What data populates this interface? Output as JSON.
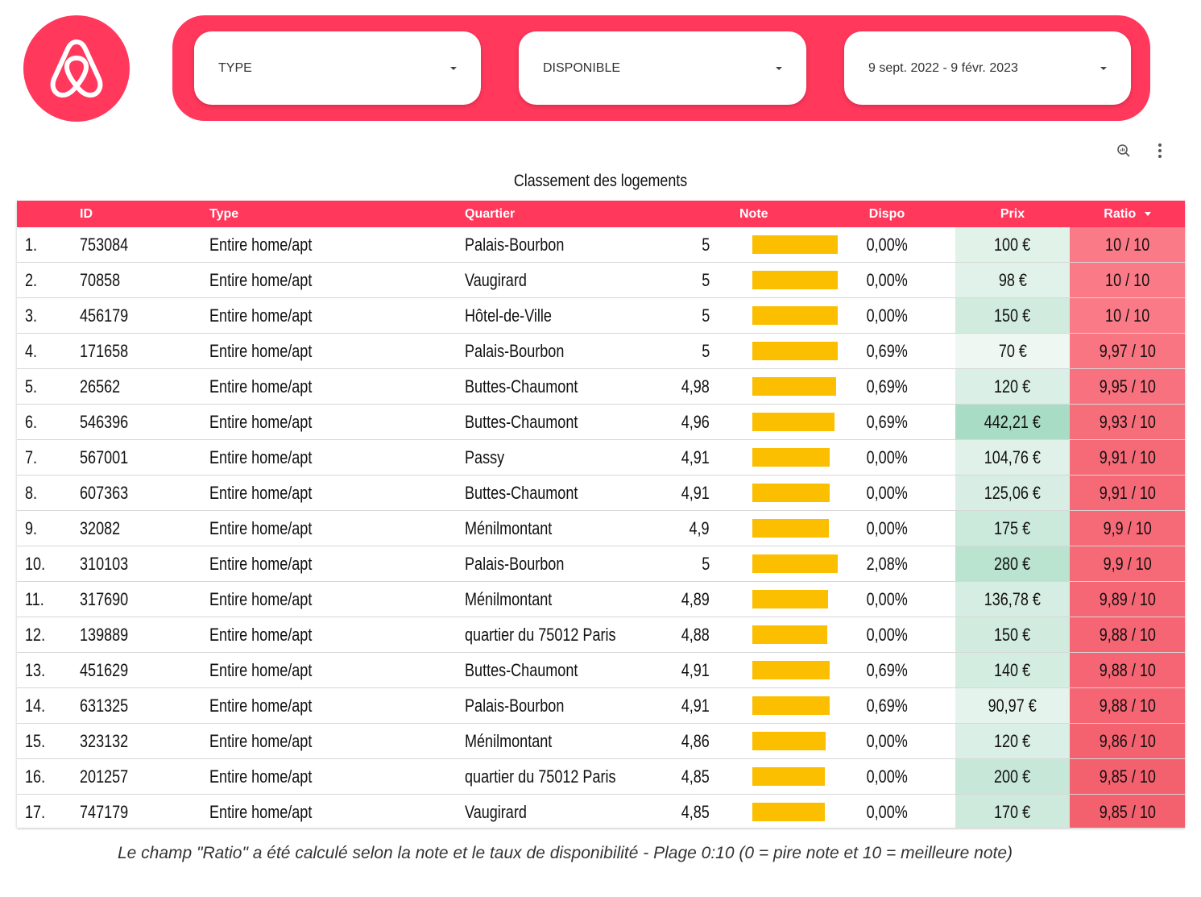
{
  "filters": {
    "type_label": "TYPE",
    "dispo_label": "DISPONIBLE",
    "date_label": "9 sept. 2022 - 9 févr. 2023"
  },
  "colors": {
    "brand": "#ff385c",
    "note_bar": "#fbbf00"
  },
  "table": {
    "title": "Classement des logements",
    "headers": {
      "id": "ID",
      "type": "Type",
      "quartier": "Quartier",
      "note": "Note",
      "dispo": "Dispo",
      "prix": "Prix",
      "ratio": "Ratio"
    },
    "sort_icon": "arrow-down-icon",
    "rows": [
      {
        "rank": "1.",
        "id": "753084",
        "type": "Entire home/apt",
        "quartier": "Palais-Bourbon",
        "note": "5",
        "note_value": 5,
        "dispo": "0,00%",
        "prix": "100 €",
        "price_value": 100,
        "ratio": "10 / 10",
        "ratio_value": 10
      },
      {
        "rank": "2.",
        "id": "70858",
        "type": "Entire home/apt",
        "quartier": "Vaugirard",
        "note": "5",
        "note_value": 5,
        "dispo": "0,00%",
        "prix": "98 €",
        "price_value": 98,
        "ratio": "10 / 10",
        "ratio_value": 10
      },
      {
        "rank": "3.",
        "id": "456179",
        "type": "Entire home/apt",
        "quartier": "Hôtel-de-Ville",
        "note": "5",
        "note_value": 5,
        "dispo": "0,00%",
        "prix": "150 €",
        "price_value": 150,
        "ratio": "10 / 10",
        "ratio_value": 10
      },
      {
        "rank": "4.",
        "id": "171658",
        "type": "Entire home/apt",
        "quartier": "Palais-Bourbon",
        "note": "5",
        "note_value": 5,
        "dispo": "0,69%",
        "prix": "70 €",
        "price_value": 70,
        "ratio": "9,97 / 10",
        "ratio_value": 9.97
      },
      {
        "rank": "5.",
        "id": "26562",
        "type": "Entire home/apt",
        "quartier": "Buttes-Chaumont",
        "note": "4,98",
        "note_value": 4.98,
        "dispo": "0,69%",
        "prix": "120 €",
        "price_value": 120,
        "ratio": "9,95 / 10",
        "ratio_value": 9.95
      },
      {
        "rank": "6.",
        "id": "546396",
        "type": "Entire home/apt",
        "quartier": "Buttes-Chaumont",
        "note": "4,96",
        "note_value": 4.96,
        "dispo": "0,69%",
        "prix": "442,21 €",
        "price_value": 442.21,
        "ratio": "9,93 / 10",
        "ratio_value": 9.93
      },
      {
        "rank": "7.",
        "id": "567001",
        "type": "Entire home/apt",
        "quartier": "Passy",
        "note": "4,91",
        "note_value": 4.91,
        "dispo": "0,00%",
        "prix": "104,76 €",
        "price_value": 104.76,
        "ratio": "9,91 / 10",
        "ratio_value": 9.91
      },
      {
        "rank": "8.",
        "id": "607363",
        "type": "Entire home/apt",
        "quartier": "Buttes-Chaumont",
        "note": "4,91",
        "note_value": 4.91,
        "dispo": "0,00%",
        "prix": "125,06 €",
        "price_value": 125.06,
        "ratio": "9,91 / 10",
        "ratio_value": 9.91
      },
      {
        "rank": "9.",
        "id": "32082",
        "type": "Entire home/apt",
        "quartier": "Ménilmontant",
        "note": "4,9",
        "note_value": 4.9,
        "dispo": "0,00%",
        "prix": "175 €",
        "price_value": 175,
        "ratio": "9,9 / 10",
        "ratio_value": 9.9
      },
      {
        "rank": "10.",
        "id": "310103",
        "type": "Entire home/apt",
        "quartier": "Palais-Bourbon",
        "note": "5",
        "note_value": 5,
        "dispo": "2,08%",
        "prix": "280 €",
        "price_value": 280,
        "ratio": "9,9 / 10",
        "ratio_value": 9.9
      },
      {
        "rank": "11.",
        "id": "317690",
        "type": "Entire home/apt",
        "quartier": "Ménilmontant",
        "note": "4,89",
        "note_value": 4.89,
        "dispo": "0,00%",
        "prix": "136,78 €",
        "price_value": 136.78,
        "ratio": "9,89 / 10",
        "ratio_value": 9.89
      },
      {
        "rank": "12.",
        "id": "139889",
        "type": "Entire home/apt",
        "quartier": "quartier du 75012 Paris",
        "note": "4,88",
        "note_value": 4.88,
        "dispo": "0,00%",
        "prix": "150 €",
        "price_value": 150,
        "ratio": "9,88 / 10",
        "ratio_value": 9.88
      },
      {
        "rank": "13.",
        "id": "451629",
        "type": "Entire home/apt",
        "quartier": "Buttes-Chaumont",
        "note": "4,91",
        "note_value": 4.91,
        "dispo": "0,69%",
        "prix": "140 €",
        "price_value": 140,
        "ratio": "9,88 / 10",
        "ratio_value": 9.88
      },
      {
        "rank": "14.",
        "id": "631325",
        "type": "Entire home/apt",
        "quartier": "Palais-Bourbon",
        "note": "4,91",
        "note_value": 4.91,
        "dispo": "0,69%",
        "prix": "90,97 €",
        "price_value": 90.97,
        "ratio": "9,88 / 10",
        "ratio_value": 9.88
      },
      {
        "rank": "15.",
        "id": "323132",
        "type": "Entire home/apt",
        "quartier": "Ménilmontant",
        "note": "4,86",
        "note_value": 4.86,
        "dispo": "0,00%",
        "prix": "120 €",
        "price_value": 120,
        "ratio": "9,86 / 10",
        "ratio_value": 9.86
      },
      {
        "rank": "16.",
        "id": "201257",
        "type": "Entire home/apt",
        "quartier": "quartier du 75012 Paris",
        "note": "4,85",
        "note_value": 4.85,
        "dispo": "0,00%",
        "prix": "200 €",
        "price_value": 200,
        "ratio": "9,85 / 10",
        "ratio_value": 9.85
      },
      {
        "rank": "17.",
        "id": "747179",
        "type": "Entire home/apt",
        "quartier": "Vaugirard",
        "note": "4,85",
        "note_value": 4.85,
        "dispo": "0,00%",
        "prix": "170 €",
        "price_value": 170,
        "ratio": "9,85 / 10",
        "ratio_value": 9.85
      }
    ]
  },
  "footer": {
    "caption": "Le champ \"Ratio\" a été calculé selon la note et le taux de disponibilité - Plage 0:10 (0 = pire note et 10 = meilleure note)"
  }
}
